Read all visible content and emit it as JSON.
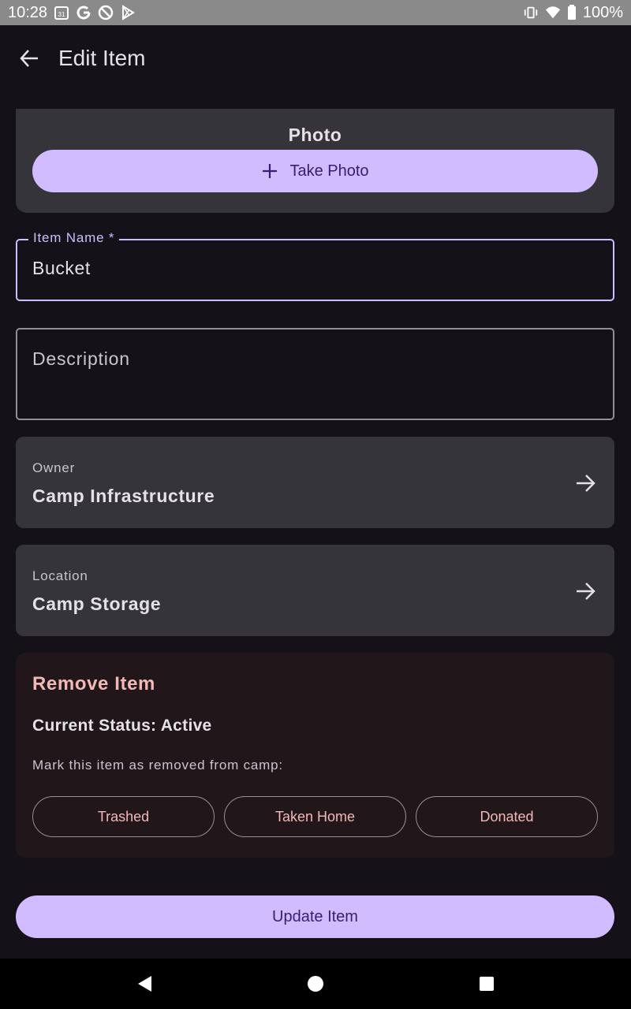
{
  "status_bar": {
    "time": "10:28",
    "battery": "100%",
    "left_icons": [
      "calendar-icon",
      "google-icon",
      "at-icon",
      "play-store-icon"
    ],
    "calendar_day": "31",
    "right_icons": [
      "vibrate-icon",
      "wifi-icon",
      "battery-icon"
    ]
  },
  "app_bar": {
    "title": "Edit Item",
    "back_icon": "arrow-back-icon"
  },
  "photo": {
    "label": "Photo",
    "take_photo_label": "Take Photo",
    "icon": "plus-icon"
  },
  "item_name": {
    "label": "Item Name *",
    "value": "Bucket"
  },
  "description": {
    "placeholder": "Description",
    "value": ""
  },
  "owner": {
    "label": "Owner",
    "value": "Camp Infrastructure",
    "icon": "arrow-forward-icon"
  },
  "location": {
    "label": "Location",
    "value": "Camp Storage",
    "icon": "arrow-forward-icon"
  },
  "remove_item": {
    "title": "Remove Item",
    "current_status": "Current Status: Active",
    "instruction": "Mark this item as removed from camp:",
    "buttons": [
      "Trashed",
      "Taken Home",
      "Donated"
    ]
  },
  "update_button": "Update Item",
  "colors": {
    "background": "#141218",
    "primary": "#d0bcff",
    "on_primary": "#381e72",
    "surface_variant": "#36343b",
    "error_text": "#f2b8b5",
    "remove_card_bg": "#211619"
  },
  "nav_bar": {
    "icons": [
      "back-triangle-icon",
      "home-circle-icon",
      "recents-square-icon"
    ]
  }
}
